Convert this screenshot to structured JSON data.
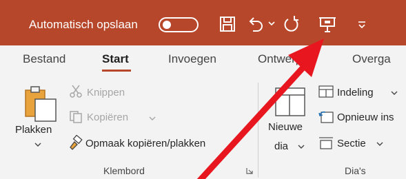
{
  "quick_access": {
    "autosave_label": "Automatisch opslaan",
    "icons": [
      "toggle-off",
      "save-icon",
      "undo-icon",
      "chevron-down-icon",
      "redo-icon",
      "present-icon",
      "customize-icon"
    ]
  },
  "tabs": [
    {
      "label": "Bestand"
    },
    {
      "label": "Start",
      "active": true
    },
    {
      "label": "Invoegen"
    },
    {
      "label": "Ontwerpen"
    },
    {
      "label": "Overga"
    }
  ],
  "clipboard": {
    "paste_label": "Plakken",
    "cut_label": "Knippen",
    "copy_label": "Kopiëren",
    "format_painter_label": "Opmaak kopiëren/plakken",
    "group_label": "Klembord"
  },
  "slides": {
    "new_slide_line1": "Nieuwe",
    "new_slide_line2": "dia",
    "layout_label": "Indeling",
    "reset_label": "Opnieuw ins",
    "section_label": "Sectie",
    "group_label": "Dia's"
  },
  "colors": {
    "titlebar": "#b7472a",
    "annotation_arrow": "#e8161f",
    "ribbon_bg": "#f3f3f3"
  }
}
